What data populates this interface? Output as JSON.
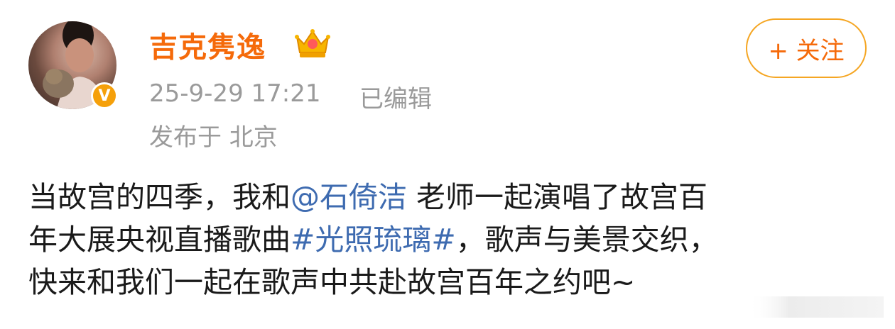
{
  "post": {
    "username": "吉克隽逸",
    "verified_badge": "V",
    "timestamp": "25-9-29 17:21",
    "edited_label": "已编辑",
    "location": "发布于 北京",
    "follow_label": "+ 关注",
    "content": {
      "line1_a": "当故宫的四季，我和",
      "mention": "@石倚洁",
      "line1_b": " 老师一起演唱了故宫百",
      "line2_a": "年大展央视直播歌曲",
      "hashtag": "#光照琉璃#",
      "line2_b": "，歌声与美景交织，",
      "line3": "快来和我们一起在歌声中共赴故宫百年之约吧~"
    }
  },
  "colors": {
    "username": "#f56a0a",
    "meta": "#9a9a9a",
    "link": "#3e6bb0",
    "follow_border": "#f5a623",
    "badge": "#f5a00a"
  },
  "icons": [
    "crown-icon",
    "verified-badge-icon"
  ]
}
